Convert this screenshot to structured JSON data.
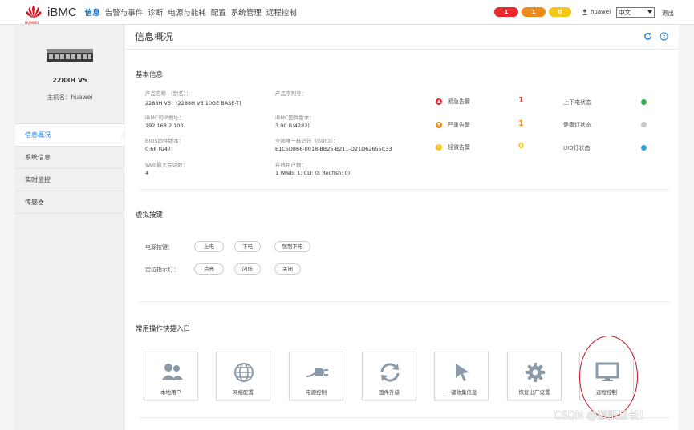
{
  "header": {
    "logo_text": "HUAWEI",
    "brand": "iBMC",
    "nav": [
      "信息",
      "告警与事件",
      "诊断",
      "电源与能耗",
      "配置",
      "系统管理",
      "远程控制"
    ],
    "alarm_counts": {
      "critical": "1",
      "major": "1",
      "minor": "0"
    },
    "user": "huawei",
    "language": "中文",
    "logout": "退出",
    "colors": {
      "critical": "#e8282b",
      "major": "#f08a1a",
      "minor": "#f5c518",
      "accent": "#1a7bd2"
    }
  },
  "sidebar": {
    "model": "2288H V5",
    "hostname": "主机名：huawei",
    "items": [
      "信息概况",
      "系统信息",
      "实时监控",
      "传感器"
    ]
  },
  "main": {
    "title": "信息概况",
    "basic_info": {
      "title": "基本信息",
      "fields": [
        {
          "label": "产品名称 （别名）：",
          "value": "2288H V5 （2288H V5 10GE BASE-T)"
        },
        {
          "label": "产品序列号：",
          "value": ""
        },
        {
          "label": "iBMC的IP地址：",
          "value": "192.168.2.100"
        },
        {
          "label": "iBMC固件版本：",
          "value": "3.00 (U4282)"
        },
        {
          "label": "BIOS固件版本：",
          "value": "0.68 (U47)"
        },
        {
          "label": "全局唯一标识符（GUID）：",
          "value": "E1C5D866-0018-BB25-B211-D21D62655C33"
        },
        {
          "label": "Web最大会话数：",
          "value": "4"
        },
        {
          "label": "在线用户数：",
          "value": "1 (Web: 1; CLI: 0; Redfish: 0)"
        }
      ],
      "alarms": [
        {
          "label": "紧急告警",
          "count": "1",
          "color": "#e8282b",
          "icon": "alarm-critical-icon"
        },
        {
          "label": "严重告警",
          "count": "1",
          "color": "#f08a1a",
          "icon": "alarm-major-icon"
        },
        {
          "label": "轻微告警",
          "count": "0",
          "color": "#f5c518",
          "icon": "alarm-minor-icon"
        }
      ],
      "status": [
        {
          "label": "上下电状态",
          "color": "#2ab24a"
        },
        {
          "label": "健康灯状态",
          "color": "#c8c8c8"
        },
        {
          "label": "UID灯状态",
          "color": "#2aa6dc"
        }
      ]
    },
    "virtual_keys": {
      "title": "虚拟按键",
      "power_label": "电源按键：",
      "power_buttons": [
        "上电",
        "下电",
        "强制下电"
      ],
      "led_label": "定位指示灯：",
      "led_buttons": [
        "点亮",
        "闪烁",
        "关闭"
      ]
    },
    "shortcuts": {
      "title": "常用操作快捷入口",
      "tiles": [
        {
          "label": "本地用户",
          "icon": "users-icon"
        },
        {
          "label": "网络配置",
          "icon": "globe-icon"
        },
        {
          "label": "电源控制",
          "icon": "power-plug-icon"
        },
        {
          "label": "固件升级",
          "icon": "refresh-arrows-icon"
        },
        {
          "label": "一键收集信息",
          "icon": "cursor-icon"
        },
        {
          "label": "恢复出厂设置",
          "icon": "gear-icon"
        },
        {
          "label": "远程控制",
          "icon": "monitor-icon"
        }
      ]
    }
  },
  "watermark": "CSDN @道阻且长！"
}
